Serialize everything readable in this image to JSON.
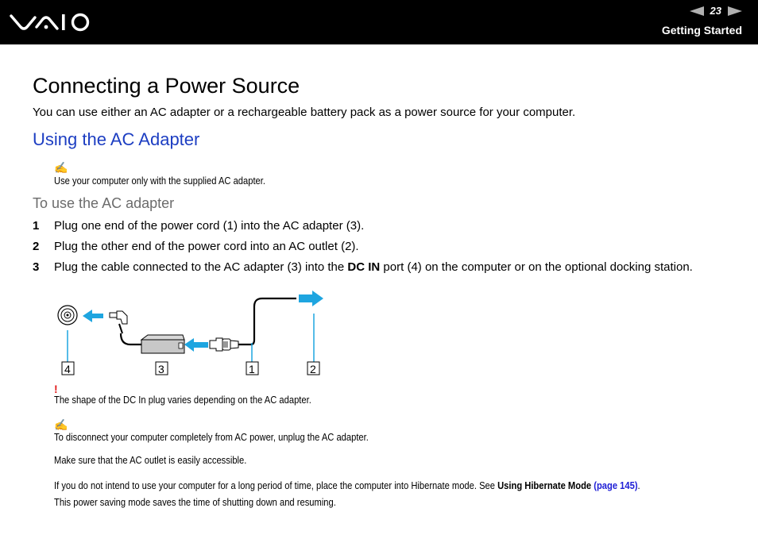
{
  "header": {
    "logo": "VAIO",
    "page_number": "23",
    "section": "Getting Started",
    "prev_icon": "triangle-left-arrow",
    "next_icon": "triangle-right-arrow"
  },
  "title": "Connecting a Power Source",
  "intro": "You can use either an AC adapter or a rechargeable battery pack as a power source for your computer.",
  "subtitle": "Using the AC Adapter",
  "note1": {
    "icon": "pencil-note-icon",
    "text": "Use your computer only with the supplied AC adapter."
  },
  "procedure": {
    "title": "To use the AC adapter",
    "steps": [
      {
        "num": "1",
        "text": "Plug one end of the power cord (1) into the AC adapter (3)."
      },
      {
        "num": "2",
        "text": "Plug the other end of the power cord into an AC outlet (2)."
      },
      {
        "num": "3",
        "pre": "Plug the cable connected to the AC adapter (3) into the ",
        "bold": "DC IN",
        "post": " port (4) on the computer or on the optional docking station."
      }
    ]
  },
  "diagram": {
    "callouts": [
      "4",
      "3",
      "1",
      "2"
    ],
    "accent_color": "#1ea5e0"
  },
  "warning": {
    "icon": "!",
    "text": "The shape of the DC In plug varies depending on the AC adapter."
  },
  "note2": {
    "icon": "pencil-note-icon",
    "text": "To disconnect your computer completely from AC power, unplug the AC adapter.",
    "text2": "Make sure that the AC outlet is easily accessible.",
    "text3_pre": "If you do not intend to use your computer for a long period of time, place the computer into Hibernate mode. See ",
    "text3_bold": "Using Hibernate Mode",
    "text3_link": "(page 145)",
    "text3_post": ".",
    "text4": "This power saving mode saves the time of shutting down and resuming."
  }
}
